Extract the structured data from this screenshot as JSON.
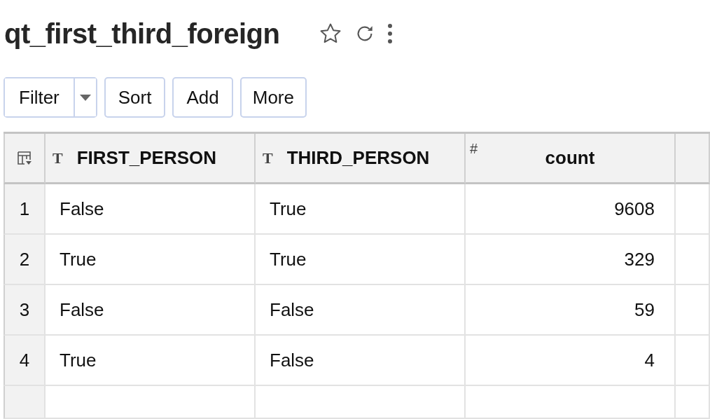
{
  "title": "qt_first_third_foreign",
  "toolbar": {
    "split_button": {
      "label": "Filter"
    },
    "buttons": [
      "Sort",
      "Add",
      "More"
    ]
  },
  "table": {
    "columns": [
      {
        "type_glyph": "T",
        "label": "FIRST_PERSON",
        "kind": "text"
      },
      {
        "type_glyph": "T",
        "label": "THIRD_PERSON",
        "kind": "text"
      },
      {
        "type_glyph": "#",
        "label": "count",
        "kind": "number"
      }
    ],
    "rows": [
      {
        "index": "1",
        "cells": [
          "False",
          "True",
          "9608"
        ]
      },
      {
        "index": "2",
        "cells": [
          "True",
          "True",
          "329"
        ]
      },
      {
        "index": "3",
        "cells": [
          "False",
          "False",
          "59"
        ]
      },
      {
        "index": "4",
        "cells": [
          "True",
          "False",
          "4"
        ]
      }
    ]
  }
}
